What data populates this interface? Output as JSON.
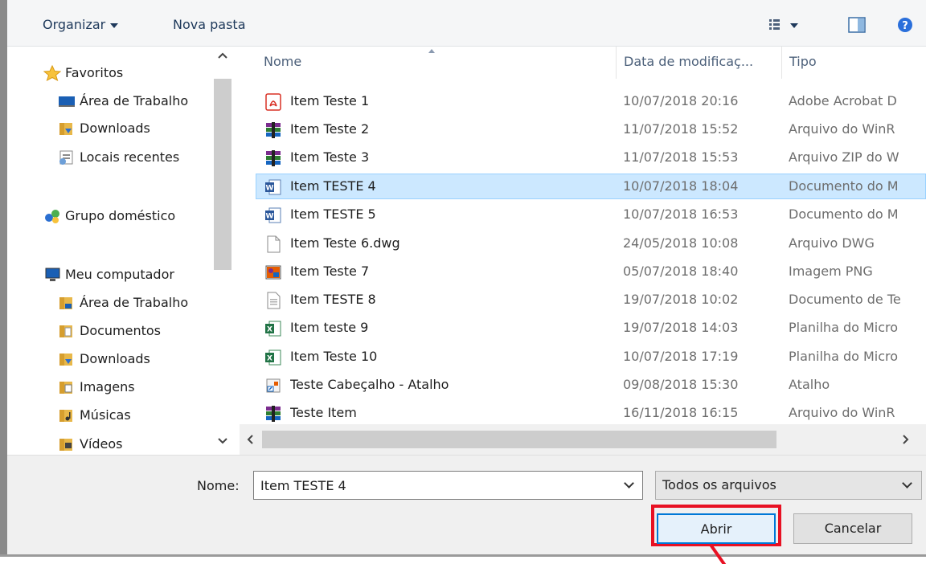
{
  "toolbar": {
    "organize_label": "Organizar",
    "new_folder_label": "Nova pasta",
    "view_icon": "view-options-icon",
    "preview_icon": "preview-pane-icon",
    "help_icon": "help-icon"
  },
  "nav": {
    "favorites": "Favoritos",
    "fav_items": [
      "Área de Trabalho",
      "Downloads",
      "Locais recentes"
    ],
    "homegroup": "Grupo doméstico",
    "computer": "Meu computador",
    "computer_items": [
      "Área de Trabalho",
      "Documentos",
      "Downloads",
      "Imagens",
      "Músicas",
      "Vídeos"
    ]
  },
  "columns": {
    "name": "Nome",
    "date": "Data de modificaç...",
    "type": "Tipo"
  },
  "files": [
    {
      "name": "Item Teste 1",
      "date": "10/07/2018 20:16",
      "type": "Adobe Acrobat D",
      "icon": "pdf-icon"
    },
    {
      "name": "Item Teste 2",
      "date": "11/07/2018 15:52",
      "type": "Arquivo do WinR",
      "icon": "winrar-icon"
    },
    {
      "name": "Item Teste 3",
      "date": "11/07/2018 15:53",
      "type": "Arquivo ZIP do W",
      "icon": "winrar-icon"
    },
    {
      "name": "Item TESTE 4",
      "date": "10/07/2018 18:04",
      "type": "Documento do M",
      "icon": "word-icon",
      "selected": true
    },
    {
      "name": "Item TESTE 5",
      "date": "10/07/2018 16:53",
      "type": "Documento do M",
      "icon": "word-icon"
    },
    {
      "name": "Item Teste 6.dwg",
      "date": "24/05/2018 10:08",
      "type": "Arquivo DWG",
      "icon": "blank-file-icon"
    },
    {
      "name": "Item Teste 7",
      "date": "05/07/2018 18:40",
      "type": "Imagem PNG",
      "icon": "image-icon"
    },
    {
      "name": "Item TESTE 8",
      "date": "19/07/2018 10:02",
      "type": "Documento de Te",
      "icon": "text-file-icon"
    },
    {
      "name": "Item teste 9",
      "date": "19/07/2018 14:03",
      "type": "Planilha do Micro",
      "icon": "excel-icon"
    },
    {
      "name": "Item Teste 10",
      "date": "10/07/2018 17:19",
      "type": "Planilha do Micro",
      "icon": "excel-icon"
    },
    {
      "name": "Teste Cabeçalho - Atalho",
      "date": "09/08/2018 15:30",
      "type": "Atalho",
      "icon": "shortcut-icon"
    },
    {
      "name": "Teste Item",
      "date": "16/11/2018 16:15",
      "type": "Arquivo do WinR",
      "icon": "winrar-icon"
    }
  ],
  "bottom": {
    "name_label": "Nome:",
    "filename_value": "Item TESTE 4",
    "filter_value": "Todos os arquivos",
    "open_label": "Abrir",
    "cancel_label": "Cancelar"
  },
  "colors": {
    "selection_bg": "#cce8ff",
    "selection_border": "#99d1ff",
    "highlight": "#e81123"
  }
}
